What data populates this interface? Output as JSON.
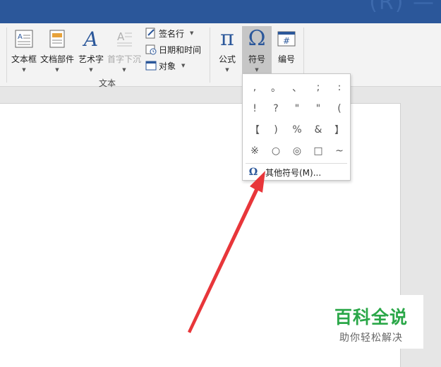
{
  "title_fragment": "(R) —",
  "ribbon": {
    "text_group": {
      "label": "文本",
      "textbox": "文本框",
      "quick_parts": "文档部件",
      "wordart": "艺术字",
      "drop_cap": "首字下沉",
      "signature_line": "签名行",
      "date_time": "日期和时间",
      "object": "对象"
    },
    "symbols_group": {
      "equation": "公式",
      "symbol": "符号",
      "number": "编号"
    }
  },
  "symbol_dropdown": {
    "symbols": [
      ",",
      "。",
      "、",
      ";",
      ":",
      "!",
      "?",
      "\"",
      "\"",
      "(",
      "【",
      ")",
      "%",
      "&",
      "】",
      "※",
      "○",
      "◎",
      "□",
      "~"
    ],
    "more_symbols": "其他符号(M)..."
  },
  "watermark": {
    "title": "百科全说",
    "subtitle": "助你轻松解决"
  },
  "colors": {
    "titlebar": "#2b579a",
    "accent_icon": "#2b579a",
    "arrow": "#e8363a",
    "watermark_green": "#2aa748"
  }
}
